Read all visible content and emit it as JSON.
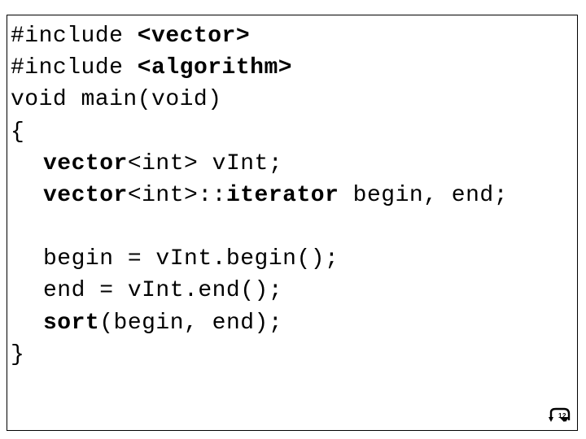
{
  "code": {
    "l1_a": "#include ",
    "l1_b": "<vector>",
    "l2_a": "#include ",
    "l2_b": "<algorithm>",
    "l3": "void main(void)",
    "l4": "{",
    "l5_a": "vector",
    "l5_b": "<int> vInt;",
    "l6_a": "vector",
    "l6_b": "<int>::",
    "l6_c": "iterator",
    "l6_d": " begin, end;",
    "l7": "begin = vInt.begin();",
    "l8": "end = vInt.end();",
    "l9_a": "sort",
    "l9_b": "(begin, end);",
    "l10": "}"
  },
  "nav": {
    "label": "return-icon",
    "page": "12"
  }
}
